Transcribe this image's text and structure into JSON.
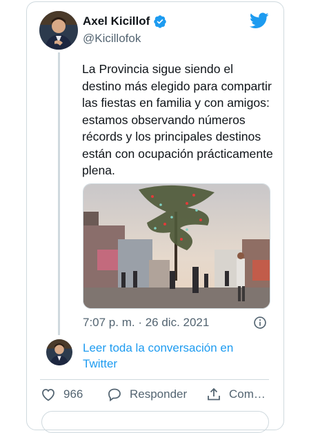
{
  "tweet": {
    "display_name": "Axel Kicillof",
    "handle": "@Kicillofok",
    "text": "La Provincia sigue siendo el destino más elegido para compartir las fiestas en familia y con amigos: estamos observando números récords y los principales destinos están con ocupación prácticamente plena.",
    "timestamp": "7:07 p. m. · 26 dic. 2021",
    "read_more": "Leer toda la conversación en Twitter"
  },
  "actions": {
    "likes": "966",
    "reply_label": "Responder",
    "share_label": "Com…"
  },
  "icons": {
    "verified": "verified-badge-icon",
    "brand": "twitter-bird-icon",
    "info": "info-icon",
    "like": "heart-icon",
    "reply": "reply-bubble-icon",
    "share": "share-icon"
  },
  "colors": {
    "accent": "#1d9bf0",
    "text": "#0f1419",
    "muted": "#536471",
    "border": "#cfd9de"
  }
}
